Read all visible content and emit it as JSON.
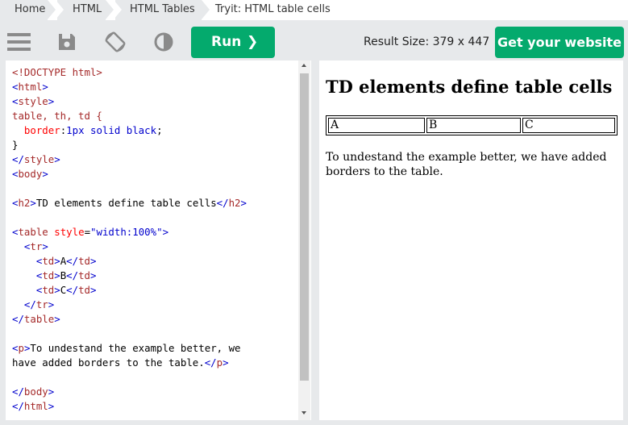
{
  "breadcrumb": {
    "items": [
      "Home",
      "HTML",
      "HTML Tables",
      "Tryit: HTML table cells"
    ]
  },
  "toolbar": {
    "menu_icon": "hamburger-menu-icon",
    "save_icon": "save-disk-icon",
    "rotate_icon": "rotate-orientation-icon",
    "theme_icon": "contrast-icon",
    "run_label": "Run",
    "result_size": "Result Size: 379 x 447",
    "get_website_label": "Get your website",
    "accent_color": "#04aa6d"
  },
  "editor": {
    "lines": [
      "<!DOCTYPE html>",
      "<html>",
      "<style>",
      "table, th, td {",
      "  border:1px solid black;",
      "}",
      "</style>",
      "<body>",
      "",
      "<h2>TD elements define table cells</h2>",
      "",
      "<table style=\"width:100%\">",
      "  <tr>",
      "    <td>A</td>",
      "    <td>B</td>",
      "    <td>C</td>",
      "  </tr>",
      "</table>",
      "",
      "<p>To undestand the example better, we",
      "have added borders to the table.</p>",
      "",
      "</body>",
      "</html>"
    ]
  },
  "result": {
    "heading": "TD elements define table cells",
    "cells": [
      "A",
      "B",
      "C"
    ],
    "paragraph": "To undestand the example better, we have added borders to the table."
  }
}
